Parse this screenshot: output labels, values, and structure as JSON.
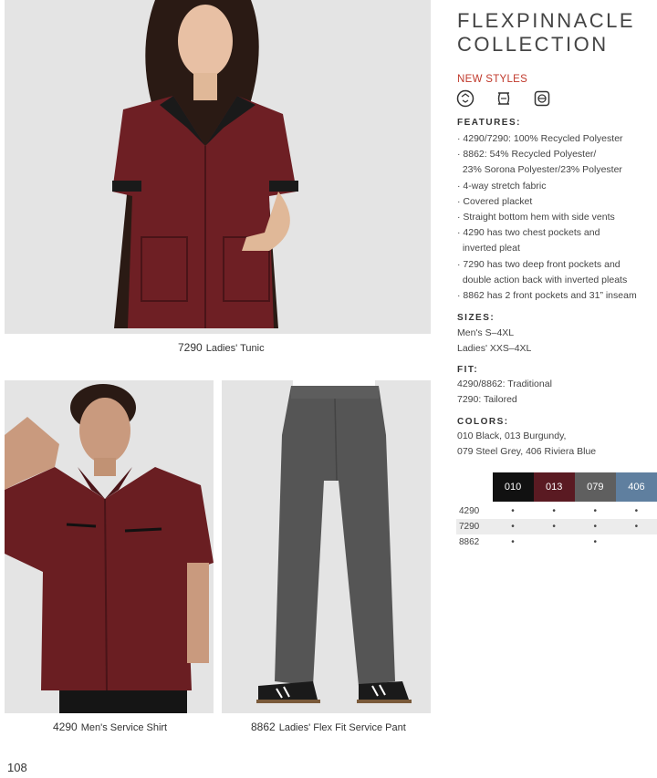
{
  "page_title": [
    "FLEXPINNACLE",
    "COLLECTION"
  ],
  "new_styles_label": "NEW STYLES",
  "style_icons": [
    "recycle-icon",
    "stretch-fabric-icon",
    "sorona-icon"
  ],
  "features": {
    "heading": "FEATURES:",
    "lines": [
      "· 4290/7290: 100% Recycled Polyester",
      "· 8862: 54% Recycled Polyester/",
      "  23% Sorona Polyester/23% Polyester",
      "· 4-way stretch fabric",
      "· Covered placket",
      "· Straight bottom hem with side vents",
      "· 4290 has two chest pockets and",
      "  inverted pleat",
      "· 7290 has two deep front pockets and",
      "  double action back with inverted pleats",
      "· 8862 has 2 front pockets and 31” inseam"
    ]
  },
  "sizes": {
    "heading": "SIZES:",
    "lines": [
      "Men's S–4XL",
      "Ladies' XXS–4XL"
    ]
  },
  "fit": {
    "heading": "FIT:",
    "lines": [
      "4290/8862: Traditional",
      "7290: Tailored"
    ]
  },
  "colors": {
    "heading": "COLORS:",
    "lines": [
      "010 Black, 013 Burgundy,",
      "079 Steel Grey, 406 Riviera Blue"
    ]
  },
  "color_table": {
    "columns": [
      {
        "code": "010",
        "color": "#111111"
      },
      {
        "code": "013",
        "color": "#5a1a22"
      },
      {
        "code": "079",
        "color": "#5f5f5f"
      },
      {
        "code": "406",
        "color": "#5f7f9f"
      }
    ],
    "rows": [
      {
        "style": "4290",
        "marks": [
          "•",
          "•",
          "•",
          "•"
        ]
      },
      {
        "style": "7290",
        "marks": [
          "•",
          "•",
          "•",
          "•"
        ]
      },
      {
        "style": "8862",
        "marks": [
          "•",
          "",
          "•",
          ""
        ]
      }
    ]
  },
  "products": [
    {
      "code": "7290",
      "name": "Ladies' Tunic"
    },
    {
      "code": "4290",
      "name": "Men's Service Shirt"
    },
    {
      "code": "8862",
      "name": "Ladies' Flex Fit Service Pant"
    }
  ],
  "page_number": "108"
}
